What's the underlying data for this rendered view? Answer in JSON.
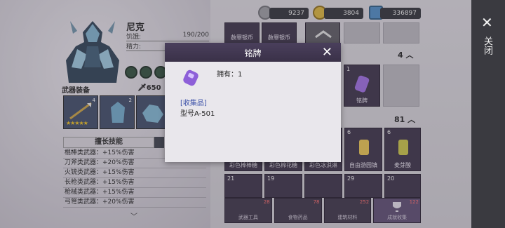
{
  "character": {
    "name": "尼克",
    "hp_label": "饥饿:",
    "hp_value": "190/200",
    "sp_label": "精力:"
  },
  "resources": [
    {
      "icon": "silver-coin-icon",
      "value": "9237"
    },
    {
      "icon": "gold-coin-icon",
      "value": "3804"
    },
    {
      "icon": "ticket-icon",
      "value": "336897"
    }
  ],
  "weapons": {
    "header": "武器装备",
    "power": "650",
    "slot_counts": [
      "4",
      "2",
      "4"
    ]
  },
  "skills": {
    "tab_label": "擅长技能",
    "lines": [
      "棍棒类武器：+15%伤害",
      "刀斧类武器：+20%伤害",
      "火铳类武器：+15%伤害",
      "长枪类武器：+15%伤害",
      "枪械类武器：+15%伤害",
      "弓弩类武器：+20%伤害"
    ]
  },
  "inventory": {
    "top_labels": [
      "赦罪银币",
      "赦罪银币"
    ],
    "section1_count": "4",
    "section1_item": {
      "num": "1",
      "label": "铭牌"
    },
    "section2_count": "81",
    "row1": [
      {
        "num": "",
        "label": "彩色棒棒糖"
      },
      {
        "num": "",
        "label": "彩色棉花糖"
      },
      {
        "num": "",
        "label": "彩色冰淇淋"
      },
      {
        "num": "6",
        "label": "自由游园镇"
      },
      {
        "num": "6",
        "label": "麦芽酸"
      }
    ],
    "row2_nums": [
      "21",
      "19",
      "",
      "29",
      "20"
    ],
    "categories": [
      {
        "label": "武器工具",
        "badge": "28"
      },
      {
        "label": "食物药品",
        "badge": "78"
      },
      {
        "label": "建筑材料",
        "badge": "252"
      },
      {
        "label": "成就收集",
        "badge": "122"
      }
    ]
  },
  "side_panel": {
    "close_text": "关闭"
  },
  "modal": {
    "title": "铭牌",
    "owned": "拥有：1",
    "category": "[收集品]",
    "model": "型号A-501"
  },
  "colors": {
    "modal_header": "#3a3148",
    "category_text": "#3b50a8",
    "side_panel": "#3a3a40"
  }
}
